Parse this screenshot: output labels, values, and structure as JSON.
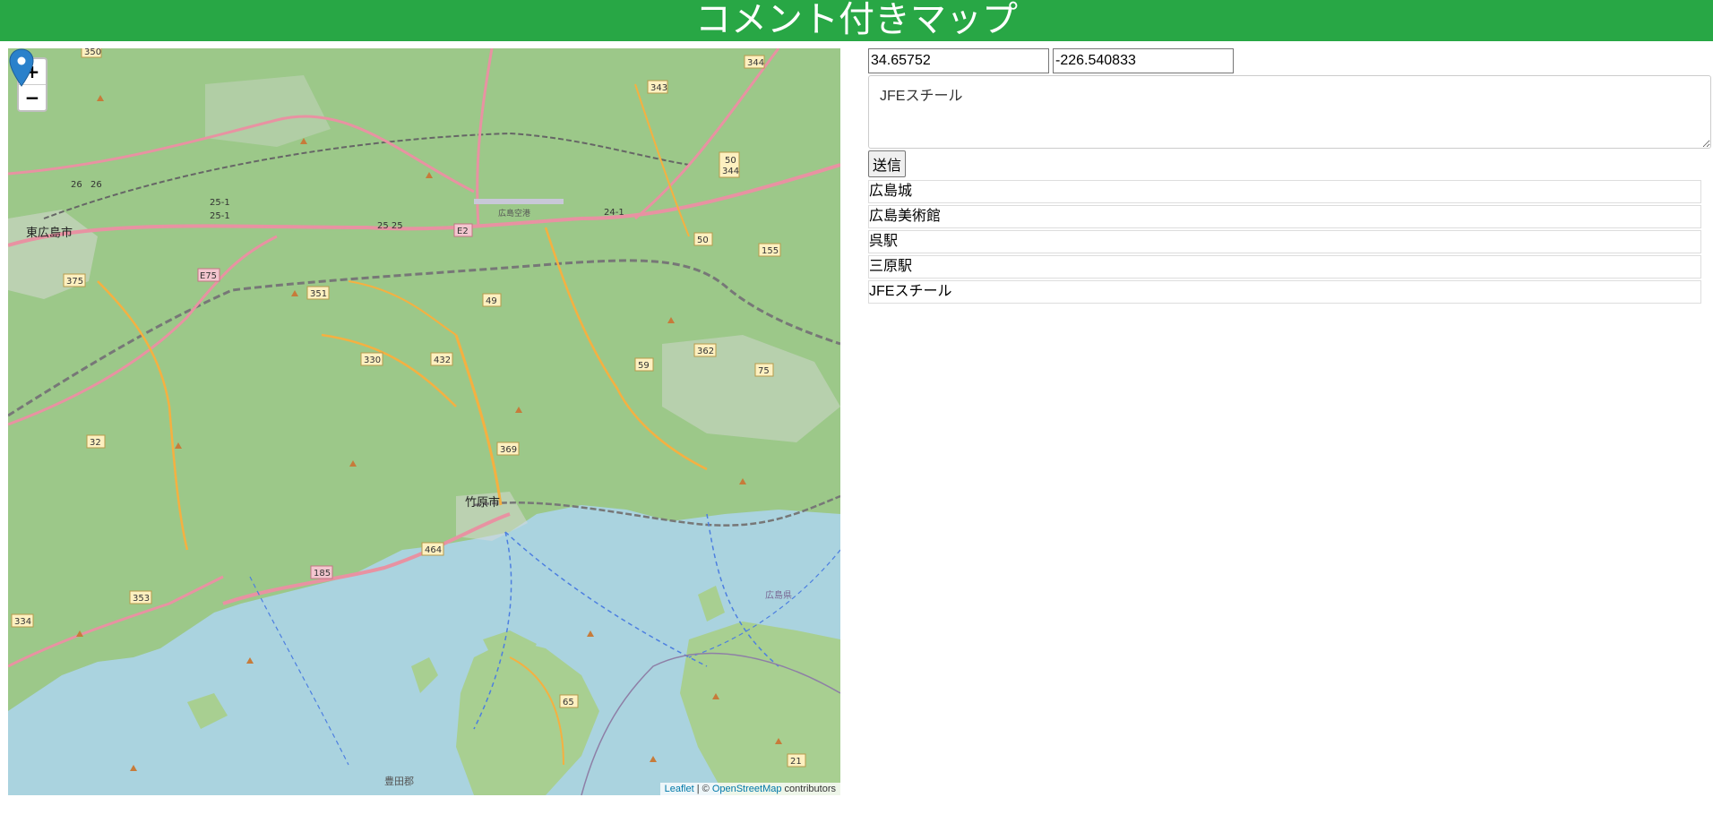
{
  "header": {
    "title": "コメント付きマップ"
  },
  "map": {
    "zoom_in": "+",
    "zoom_out": "−",
    "attribution": {
      "leaflet": "Leaflet",
      "separator": " | © ",
      "osm": "OpenStreetMap",
      "suffix": " contributors"
    },
    "place_labels": [
      "東広島市",
      "竹原市",
      "広島空港",
      "豊田郡",
      "広島県"
    ],
    "route_labels": [
      "350",
      "343",
      "344",
      "50",
      "344",
      "E2",
      "24-1",
      "25-1",
      "25-1",
      "25 25",
      "26",
      "26",
      "E75",
      "375",
      "351",
      "49",
      "155",
      "330",
      "432",
      "59",
      "362",
      "75",
      "369",
      "32",
      "464",
      "185",
      "353",
      "334",
      "65",
      "21",
      "50"
    ],
    "colors": {
      "water": "#aad3df",
      "land": "#9cc889",
      "road": "#e8902c",
      "marker": "#2a81cb"
    }
  },
  "form": {
    "lat_value": "34.65752",
    "lng_value": "-226.540833",
    "comment_value": "JFEスチール",
    "send_label": "送信"
  },
  "list": [
    "広島城",
    "広島美術館",
    "呉駅",
    "三原駅",
    "JFEスチール"
  ]
}
